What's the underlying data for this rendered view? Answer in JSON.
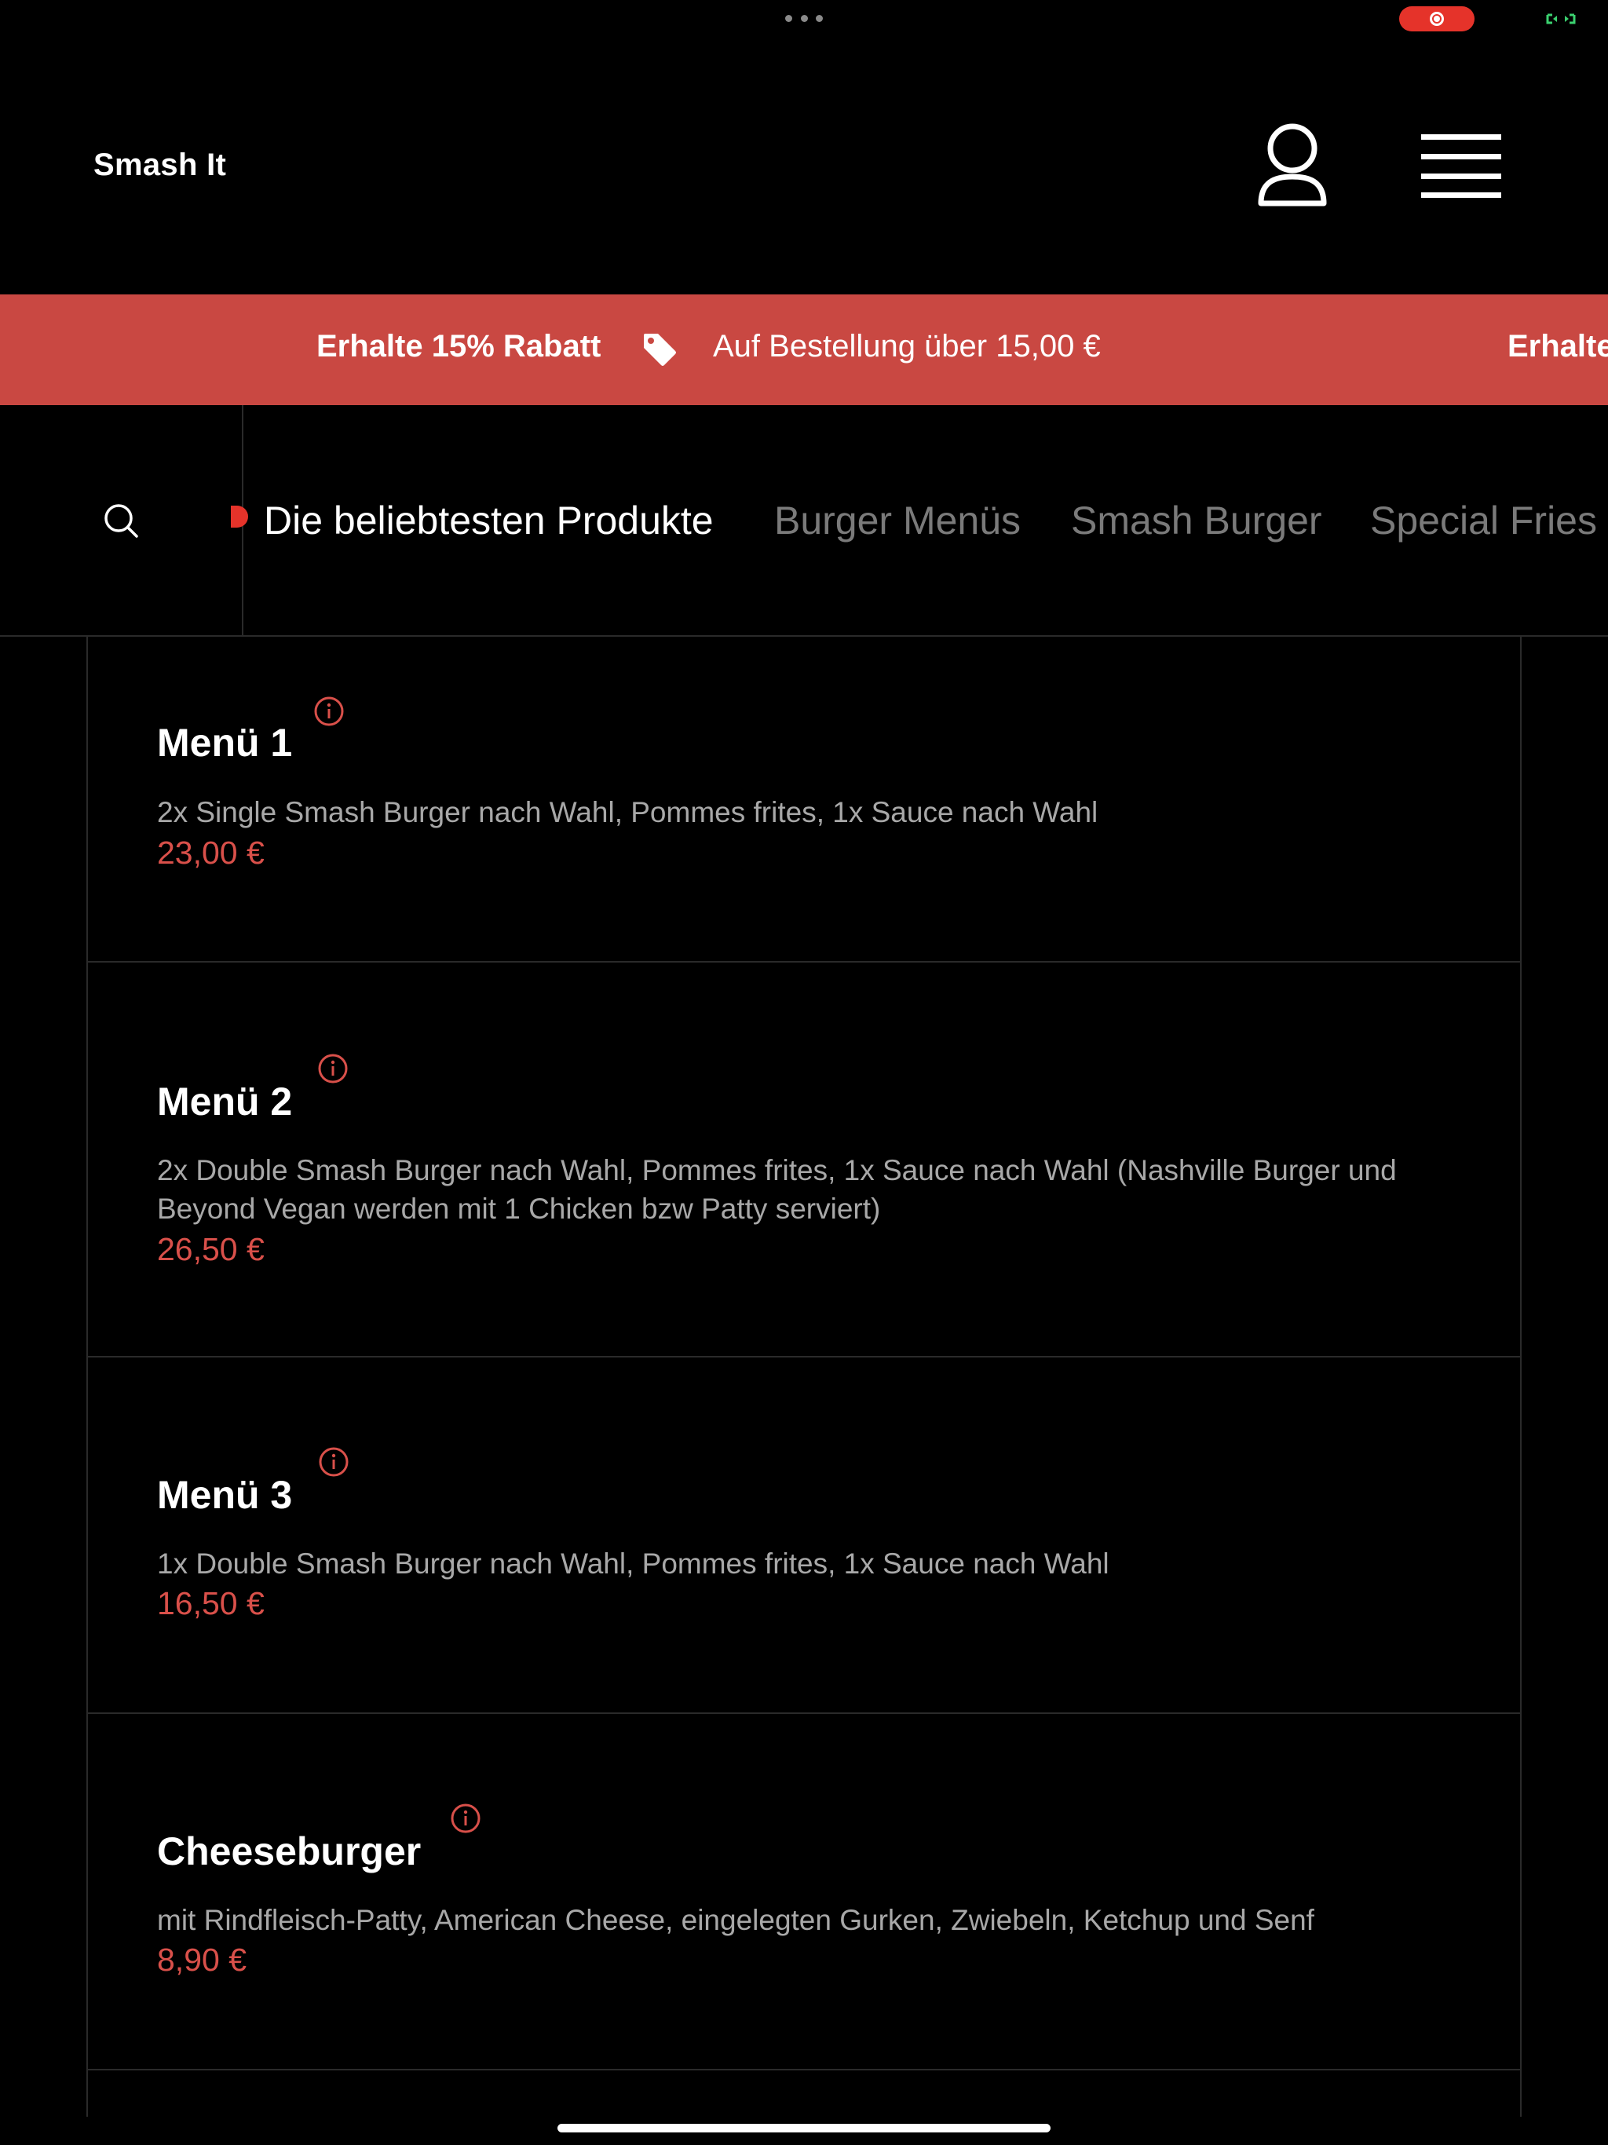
{
  "app": {
    "brand": "Smash It"
  },
  "header": {
    "account_icon": "user-icon",
    "menu_icon": "hamburger-menu-icon"
  },
  "promo": {
    "title": "Erhalte 15% Rabatt",
    "subtitle": "Auf Bestellung über 15,00 €",
    "title_repeat": "Erhalte",
    "icon": "price-tag-icon",
    "background": "#c94842"
  },
  "categories": {
    "search_icon": "search-icon",
    "tabs": [
      {
        "label": "Die beliebtesten Produkte",
        "active": true
      },
      {
        "label": "Burger Menüs",
        "active": false
      },
      {
        "label": "Smash Burger",
        "active": false
      },
      {
        "label": "Special Fries",
        "active": false
      }
    ]
  },
  "products": [
    {
      "name": "Menü 1",
      "description": "2x Single Smash Burger nach Wahl, Pommes frites, 1x Sauce nach Wahl",
      "price": "23,00 €"
    },
    {
      "name": "Menü 2",
      "description": "2x Double Smash Burger nach Wahl, Pommes frites, 1x Sauce nach Wahl (Nashville Burger und Beyond Vegan werden mit 1 Chicken bzw Patty serviert)",
      "price": "26,50 €"
    },
    {
      "name": "Menü 3",
      "description": "1x Double Smash Burger nach Wahl, Pommes frites, 1x Sauce nach Wahl",
      "price": "16,50 €"
    },
    {
      "name": "Cheeseburger",
      "description": "mit Rindfleisch-Patty, American Cheese, eingelegten Gurken, Zwiebeln, Ketchup und Senf",
      "price": "8,90 €"
    }
  ],
  "colors": {
    "accent": "#d9504a",
    "background": "#000000",
    "divider": "#2a2a2a"
  }
}
